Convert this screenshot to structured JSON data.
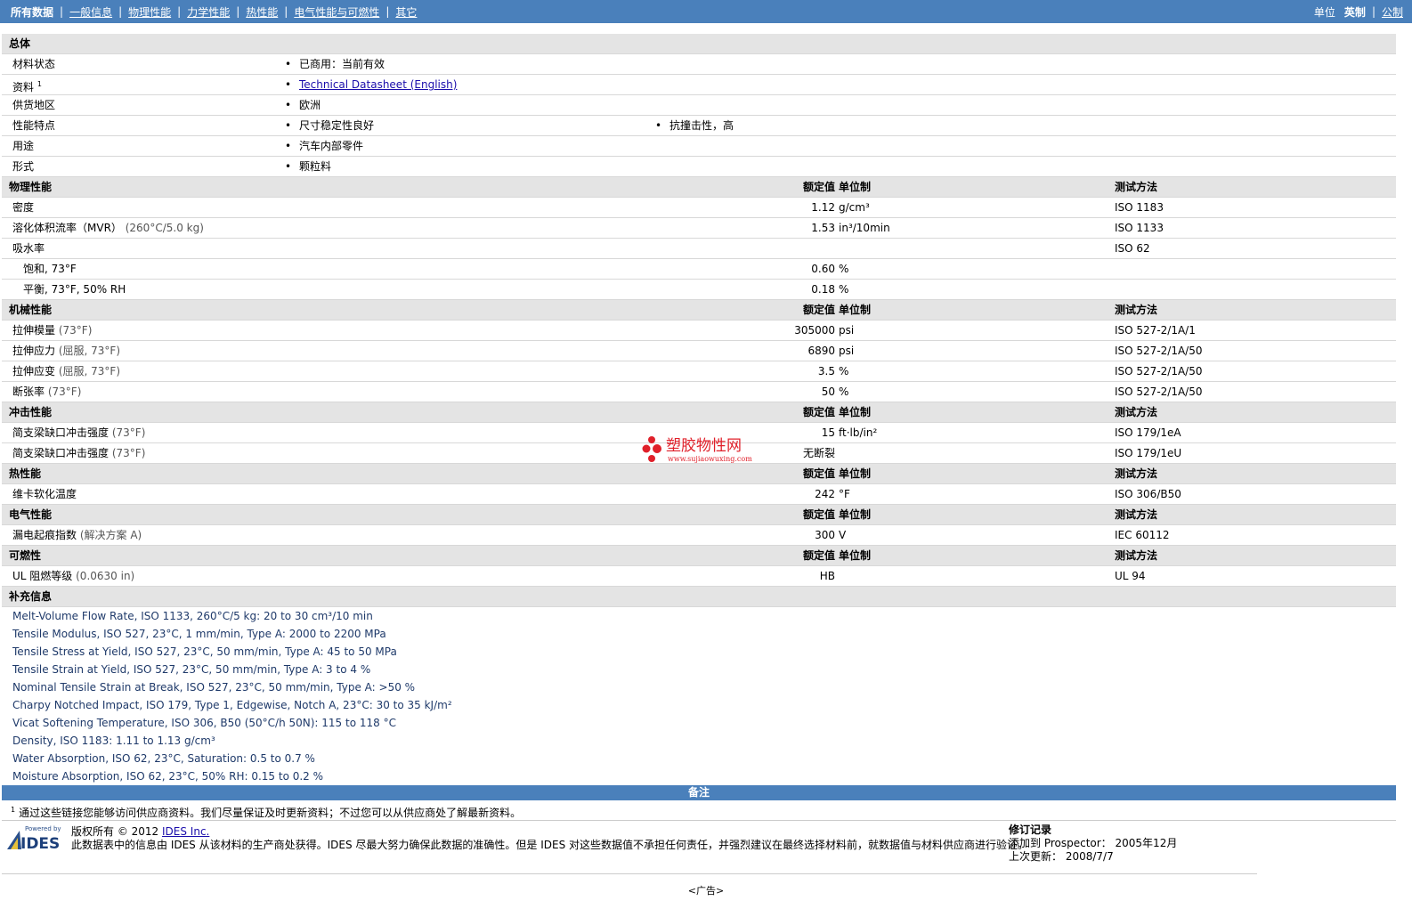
{
  "nav": {
    "tabs": [
      "所有数据",
      "一般信息",
      "物理性能",
      "力学性能",
      "热性能",
      "电气性能与可燃性",
      "其它"
    ],
    "units_label": "单位",
    "unit_en": "英制",
    "unit_metric": "公制"
  },
  "general": {
    "title": "总体",
    "rows": [
      {
        "label": "材料状态",
        "values": [
          "已商用：当前有效"
        ]
      },
      {
        "label": "资料",
        "sup": "1",
        "link": "Technical Datasheet (English)"
      },
      {
        "label": "供货地区",
        "values": [
          "欧洲"
        ]
      },
      {
        "label": "性能特点",
        "values": [
          "尺寸稳定性良好",
          "抗撞击性，高"
        ]
      },
      {
        "label": "用途",
        "values": [
          "汽车内部零件"
        ]
      },
      {
        "label": "形式",
        "values": [
          "颗粒料"
        ]
      }
    ]
  },
  "col_headers": {
    "nominal": "额定值",
    "unit": "单位制",
    "test": "测试方法"
  },
  "physical": {
    "title": "物理性能",
    "rows": [
      {
        "label": "密度",
        "value": "1.12",
        "unit": "g/cm³",
        "test": "ISO 1183"
      },
      {
        "label": "溶化体积流率（MVR）",
        "cond": "(260°C/5.0 kg)",
        "value": "1.53",
        "unit": "in³/10min",
        "test": "ISO 1133"
      },
      {
        "label": "吸水率",
        "value": "",
        "unit": "",
        "test": "ISO 62"
      },
      {
        "label": "饱和, 73°F",
        "sub": true,
        "value": "0.60",
        "unit": "%",
        "test": ""
      },
      {
        "label": "平衡, 73°F, 50% RH",
        "sub": true,
        "value": "0.18",
        "unit": "%",
        "test": ""
      }
    ]
  },
  "mechanical": {
    "title": "机械性能",
    "rows": [
      {
        "label": "拉伸模量",
        "cond": "(73°F)",
        "value": "305000",
        "unit": "psi",
        "test": "ISO 527-2/1A/1"
      },
      {
        "label": "拉伸应力",
        "cond": "(屈服, 73°F)",
        "value": "6890",
        "unit": "psi",
        "test": "ISO 527-2/1A/50"
      },
      {
        "label": "拉伸应变",
        "cond": "(屈服, 73°F)",
        "value": "3.5",
        "unit": "%",
        "test": "ISO 527-2/1A/50"
      },
      {
        "label": "断张率",
        "cond": "(73°F)",
        "value": "50",
        "unit": "%",
        "test": "ISO 527-2/1A/50"
      }
    ]
  },
  "impact": {
    "title": "冲击性能",
    "rows": [
      {
        "label": "简支梁缺口冲击强度",
        "cond": "(73°F)",
        "value": "15",
        "unit": "ft·lb/in²",
        "test": "ISO 179/1eA"
      },
      {
        "label": "简支梁缺口冲击强度",
        "cond": "(73°F)",
        "value": "无断裂",
        "unit": "",
        "test": "ISO 179/1eU"
      }
    ]
  },
  "thermal": {
    "title": "热性能",
    "rows": [
      {
        "label": "维卡软化温度",
        "value": "242",
        "unit": "°F",
        "test": "ISO 306/B50"
      }
    ]
  },
  "electrical": {
    "title": "电气性能",
    "rows": [
      {
        "label": "漏电起痕指数",
        "cond": "(解决方案 A)",
        "value": "300",
        "unit": "V",
        "test": "IEC 60112"
      }
    ]
  },
  "flammability": {
    "title": "可燃性",
    "rows": [
      {
        "label": "UL 阻燃等级",
        "cond": "(0.0630 in)",
        "value": "HB",
        "unit": "",
        "test": "UL 94"
      }
    ]
  },
  "supplemental": {
    "title": "补充信息",
    "lines": [
      "Melt-Volume Flow Rate, ISO 1133, 260°C/5 kg: 20 to 30 cm³/10 min",
      "Tensile Modulus, ISO 527, 23°C, 1 mm/min, Type A: 2000 to 2200 MPa",
      "Tensile Stress at Yield, ISO 527, 23°C, 50 mm/min, Type A: 45 to 50 MPa",
      "Tensile Strain at Yield, ISO 527, 23°C, 50 mm/min, Type A: 3 to 4 %",
      "Nominal Tensile Strain at Break, ISO 527, 23°C, 50 mm/min, Type A: >50 %",
      "Charpy Notched Impact, ISO 179, Type 1, Edgewise, Notch A, 23°C: 30 to 35 kJ/m²",
      "Vicat Softening Temperature, ISO 306, B50 (50°C/h 50N): 115 to 118 °C",
      "Density, ISO 1183: 1.11 to 1.13 g/cm³",
      "Water Absorption, ISO 62, 23°C, Saturation: 0.5 to 0.7 %",
      "Moisture Absorption, ISO 62, 23°C, 50% RH: 0.15 to 0.2 %"
    ]
  },
  "notes": {
    "title": "备注",
    "footnote_num": "1",
    "footnote": "通过这些链接您能够访问供应商资料。我们尽量保证及时更新资料；不过您可以从供应商处了解最新资料。"
  },
  "footer": {
    "powered_by": "Powered by",
    "logo_text": "IDES",
    "copyright": "版权所有 © 2012",
    "ides_link": "IDES Inc.",
    "disclaimer": "此数据表中的信息由 IDES 从该材料的生产商处获得。IDES 尽最大努力确保此数据的准确性。但是 IDES 对这些数据值不承担任何责任，并强烈建议在最终选择材料前，就数据值与材料供应商进行验证。",
    "revision_title": "修订记录",
    "added_label": "添加到 Prospector：",
    "added_value": "2005年12月",
    "updated_label": "上次更新：",
    "updated_value": "2008/7/7"
  },
  "watermark": {
    "cn": "塑胶物性网",
    "url": "www.sujiaowuxing.com"
  },
  "ad": "<广告>"
}
